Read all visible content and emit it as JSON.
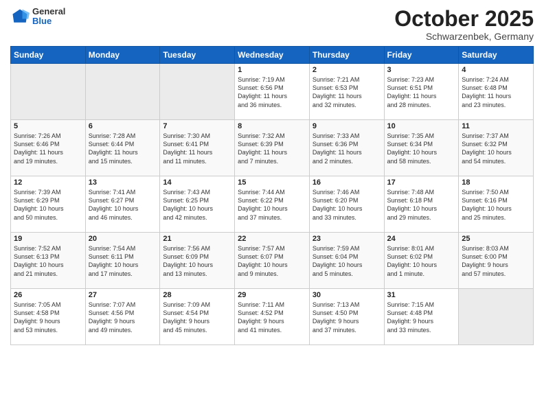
{
  "header": {
    "logo_general": "General",
    "logo_blue": "Blue",
    "month_title": "October 2025",
    "location": "Schwarzenbek, Germany"
  },
  "calendar": {
    "days_of_week": [
      "Sunday",
      "Monday",
      "Tuesday",
      "Wednesday",
      "Thursday",
      "Friday",
      "Saturday"
    ],
    "weeks": [
      [
        {
          "day": "",
          "info": ""
        },
        {
          "day": "",
          "info": ""
        },
        {
          "day": "",
          "info": ""
        },
        {
          "day": "1",
          "info": "Sunrise: 7:19 AM\nSunset: 6:56 PM\nDaylight: 11 hours\nand 36 minutes."
        },
        {
          "day": "2",
          "info": "Sunrise: 7:21 AM\nSunset: 6:53 PM\nDaylight: 11 hours\nand 32 minutes."
        },
        {
          "day": "3",
          "info": "Sunrise: 7:23 AM\nSunset: 6:51 PM\nDaylight: 11 hours\nand 28 minutes."
        },
        {
          "day": "4",
          "info": "Sunrise: 7:24 AM\nSunset: 6:48 PM\nDaylight: 11 hours\nand 23 minutes."
        }
      ],
      [
        {
          "day": "5",
          "info": "Sunrise: 7:26 AM\nSunset: 6:46 PM\nDaylight: 11 hours\nand 19 minutes."
        },
        {
          "day": "6",
          "info": "Sunrise: 7:28 AM\nSunset: 6:44 PM\nDaylight: 11 hours\nand 15 minutes."
        },
        {
          "day": "7",
          "info": "Sunrise: 7:30 AM\nSunset: 6:41 PM\nDaylight: 11 hours\nand 11 minutes."
        },
        {
          "day": "8",
          "info": "Sunrise: 7:32 AM\nSunset: 6:39 PM\nDaylight: 11 hours\nand 7 minutes."
        },
        {
          "day": "9",
          "info": "Sunrise: 7:33 AM\nSunset: 6:36 PM\nDaylight: 11 hours\nand 2 minutes."
        },
        {
          "day": "10",
          "info": "Sunrise: 7:35 AM\nSunset: 6:34 PM\nDaylight: 10 hours\nand 58 minutes."
        },
        {
          "day": "11",
          "info": "Sunrise: 7:37 AM\nSunset: 6:32 PM\nDaylight: 10 hours\nand 54 minutes."
        }
      ],
      [
        {
          "day": "12",
          "info": "Sunrise: 7:39 AM\nSunset: 6:29 PM\nDaylight: 10 hours\nand 50 minutes."
        },
        {
          "day": "13",
          "info": "Sunrise: 7:41 AM\nSunset: 6:27 PM\nDaylight: 10 hours\nand 46 minutes."
        },
        {
          "day": "14",
          "info": "Sunrise: 7:43 AM\nSunset: 6:25 PM\nDaylight: 10 hours\nand 42 minutes."
        },
        {
          "day": "15",
          "info": "Sunrise: 7:44 AM\nSunset: 6:22 PM\nDaylight: 10 hours\nand 37 minutes."
        },
        {
          "day": "16",
          "info": "Sunrise: 7:46 AM\nSunset: 6:20 PM\nDaylight: 10 hours\nand 33 minutes."
        },
        {
          "day": "17",
          "info": "Sunrise: 7:48 AM\nSunset: 6:18 PM\nDaylight: 10 hours\nand 29 minutes."
        },
        {
          "day": "18",
          "info": "Sunrise: 7:50 AM\nSunset: 6:16 PM\nDaylight: 10 hours\nand 25 minutes."
        }
      ],
      [
        {
          "day": "19",
          "info": "Sunrise: 7:52 AM\nSunset: 6:13 PM\nDaylight: 10 hours\nand 21 minutes."
        },
        {
          "day": "20",
          "info": "Sunrise: 7:54 AM\nSunset: 6:11 PM\nDaylight: 10 hours\nand 17 minutes."
        },
        {
          "day": "21",
          "info": "Sunrise: 7:56 AM\nSunset: 6:09 PM\nDaylight: 10 hours\nand 13 minutes."
        },
        {
          "day": "22",
          "info": "Sunrise: 7:57 AM\nSunset: 6:07 PM\nDaylight: 10 hours\nand 9 minutes."
        },
        {
          "day": "23",
          "info": "Sunrise: 7:59 AM\nSunset: 6:04 PM\nDaylight: 10 hours\nand 5 minutes."
        },
        {
          "day": "24",
          "info": "Sunrise: 8:01 AM\nSunset: 6:02 PM\nDaylight: 10 hours\nand 1 minute."
        },
        {
          "day": "25",
          "info": "Sunrise: 8:03 AM\nSunset: 6:00 PM\nDaylight: 9 hours\nand 57 minutes."
        }
      ],
      [
        {
          "day": "26",
          "info": "Sunrise: 7:05 AM\nSunset: 4:58 PM\nDaylight: 9 hours\nand 53 minutes."
        },
        {
          "day": "27",
          "info": "Sunrise: 7:07 AM\nSunset: 4:56 PM\nDaylight: 9 hours\nand 49 minutes."
        },
        {
          "day": "28",
          "info": "Sunrise: 7:09 AM\nSunset: 4:54 PM\nDaylight: 9 hours\nand 45 minutes."
        },
        {
          "day": "29",
          "info": "Sunrise: 7:11 AM\nSunset: 4:52 PM\nDaylight: 9 hours\nand 41 minutes."
        },
        {
          "day": "30",
          "info": "Sunrise: 7:13 AM\nSunset: 4:50 PM\nDaylight: 9 hours\nand 37 minutes."
        },
        {
          "day": "31",
          "info": "Sunrise: 7:15 AM\nSunset: 4:48 PM\nDaylight: 9 hours\nand 33 minutes."
        },
        {
          "day": "",
          "info": ""
        }
      ]
    ]
  }
}
